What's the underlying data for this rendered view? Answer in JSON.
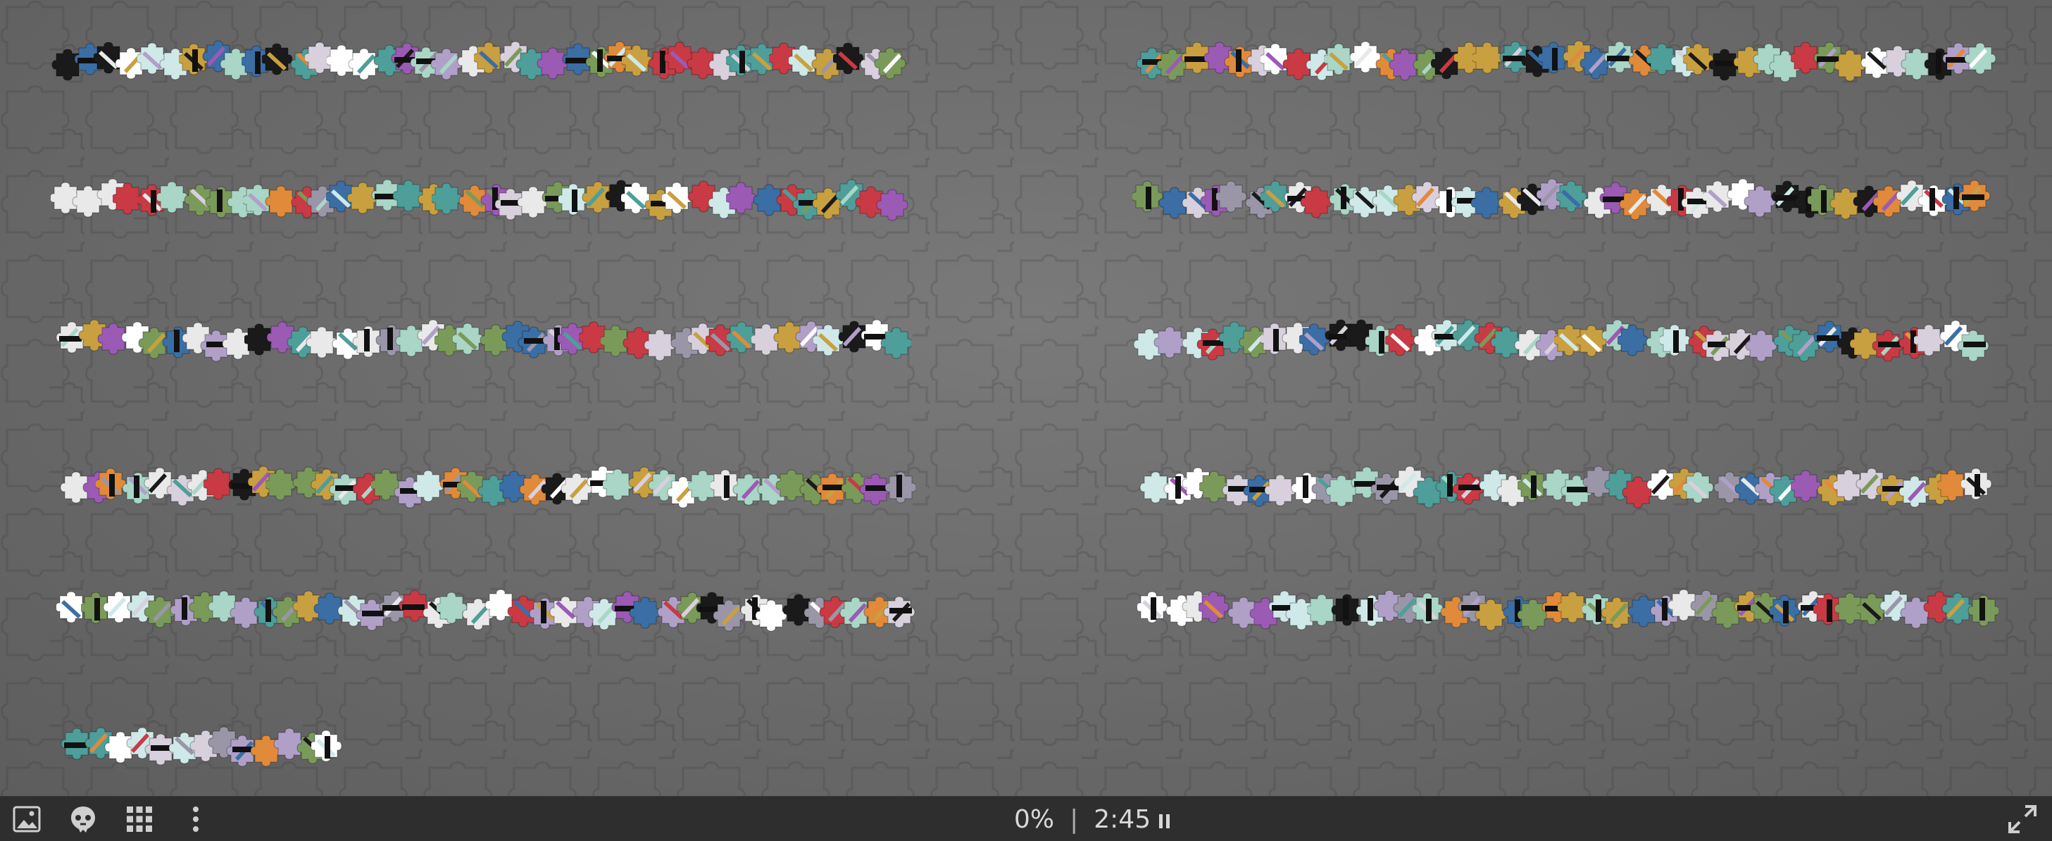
{
  "puzzle": {
    "progress_text": "0%",
    "progress_percent": 0,
    "timer_text": "2:45",
    "separator": "|"
  },
  "toolbar": {
    "left_buttons": [
      {
        "name": "show-image-button",
        "icon": "image-icon"
      },
      {
        "name": "ghost-mode-button",
        "icon": "ghost-icon"
      },
      {
        "name": "arrange-pieces-button",
        "icon": "grid-icon"
      },
      {
        "name": "more-options-button",
        "icon": "kebab-menu-icon"
      }
    ],
    "right_buttons": [
      {
        "name": "fullscreen-button",
        "icon": "expand-icon"
      }
    ]
  },
  "colors": {
    "board": "#6d6d6d",
    "toolbar": "#2e2e2e",
    "toolbar_text": "#d8d8d8",
    "piece_palette": [
      "#a9d6c6",
      "#c9a040",
      "#e9e9e9",
      "#1a1a1a",
      "#b0a0c8",
      "#d8d0dc",
      "#3a6ea5",
      "#c93a44",
      "#cfe9e9",
      "#9b5ab4",
      "#7a9a5a",
      "#e08a3a",
      "#9a96a8",
      "#4e9e9a",
      "#ffffff"
    ]
  }
}
